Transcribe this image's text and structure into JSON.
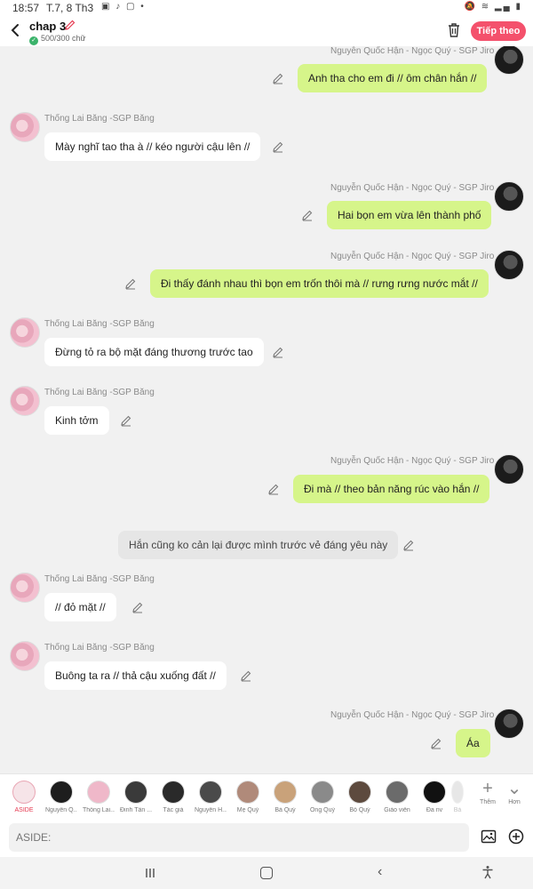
{
  "status": {
    "time": "18:57",
    "date": "T.7, 8 Th3",
    "system_icons": [
      "mute-icon",
      "wifi-icon",
      "signal-icon",
      "battery-icon"
    ]
  },
  "header": {
    "title": "chap 3",
    "char_count": "500/300 chữ",
    "next_label": "Tiếp theo",
    "accent_color": "#f4516c"
  },
  "messages": [
    {
      "side": "right",
      "name": "Nguyễn Quốc Hận - Ngọc Quý - SGP Jiro",
      "text": "Anh tha cho em đi // ôm chân hắn //"
    },
    {
      "side": "left",
      "name": "Thống Lai Băng -SGP Băng",
      "text": "Mày nghĩ tao tha à // kéo người cậu lên //"
    },
    {
      "side": "right",
      "name": "Nguyễn Quốc Hận - Ngọc Quý - SGP Jiro",
      "text": "Hai bọn em vừa lên thành phố"
    },
    {
      "side": "right",
      "name": "Nguyễn Quốc Hận - Ngọc Quý - SGP Jiro",
      "text": "Đi thấy đánh nhau thì bọn em trốn thôi mà // rưng rưng nước mắt  //"
    },
    {
      "side": "left",
      "name": "Thống Lai Băng -SGP Băng",
      "text": "Đừng tỏ ra bộ mặt đáng thương trước tao"
    },
    {
      "side": "left",
      "name": "Thống Lai Băng -SGP Băng",
      "text": "Kinh tởm"
    },
    {
      "side": "right",
      "name": "Nguyễn Quốc Hận - Ngọc Quý - SGP Jiro",
      "text": "Đi mà // theo bản năng rúc vào hắn //"
    },
    {
      "side": "center",
      "name": "",
      "text": "Hắn cũng ko cản lại được mình trước vẻ đáng yêu này"
    },
    {
      "side": "left",
      "name": "Thống Lai Băng -SGP Băng",
      "text": "// đỏ mặt //"
    },
    {
      "side": "left",
      "name": "Thống Lai Băng -SGP Băng",
      "text": "Buông ta ra // thả cậu xuống đất //"
    },
    {
      "side": "right",
      "name": "Nguyễn Quốc Hận - Ngọc Quý - SGP Jiro",
      "text": "Áa"
    }
  ],
  "characters": [
    {
      "label": "ASIDE",
      "active": true
    },
    {
      "label": "Nguyễn Q...",
      "active": false
    },
    {
      "label": "Thống Lai...",
      "active": false
    },
    {
      "label": "Đinh Tấn ...",
      "active": false
    },
    {
      "label": "Tác giả",
      "active": false
    },
    {
      "label": "Nguyễn H...",
      "active": false
    },
    {
      "label": "Mẹ Quý",
      "active": false
    },
    {
      "label": "Bà Quý",
      "active": false
    },
    {
      "label": "Ông Quý",
      "active": false
    },
    {
      "label": "Bố Quý",
      "active": false
    },
    {
      "label": "Giáo viên",
      "active": false
    },
    {
      "label": "Đa nv",
      "active": false
    },
    {
      "label": "Bà",
      "active": false
    }
  ],
  "char_more": {
    "add_label": "Thêm",
    "more_label": "Hơn"
  },
  "input": {
    "placeholder": "ASIDE:"
  }
}
